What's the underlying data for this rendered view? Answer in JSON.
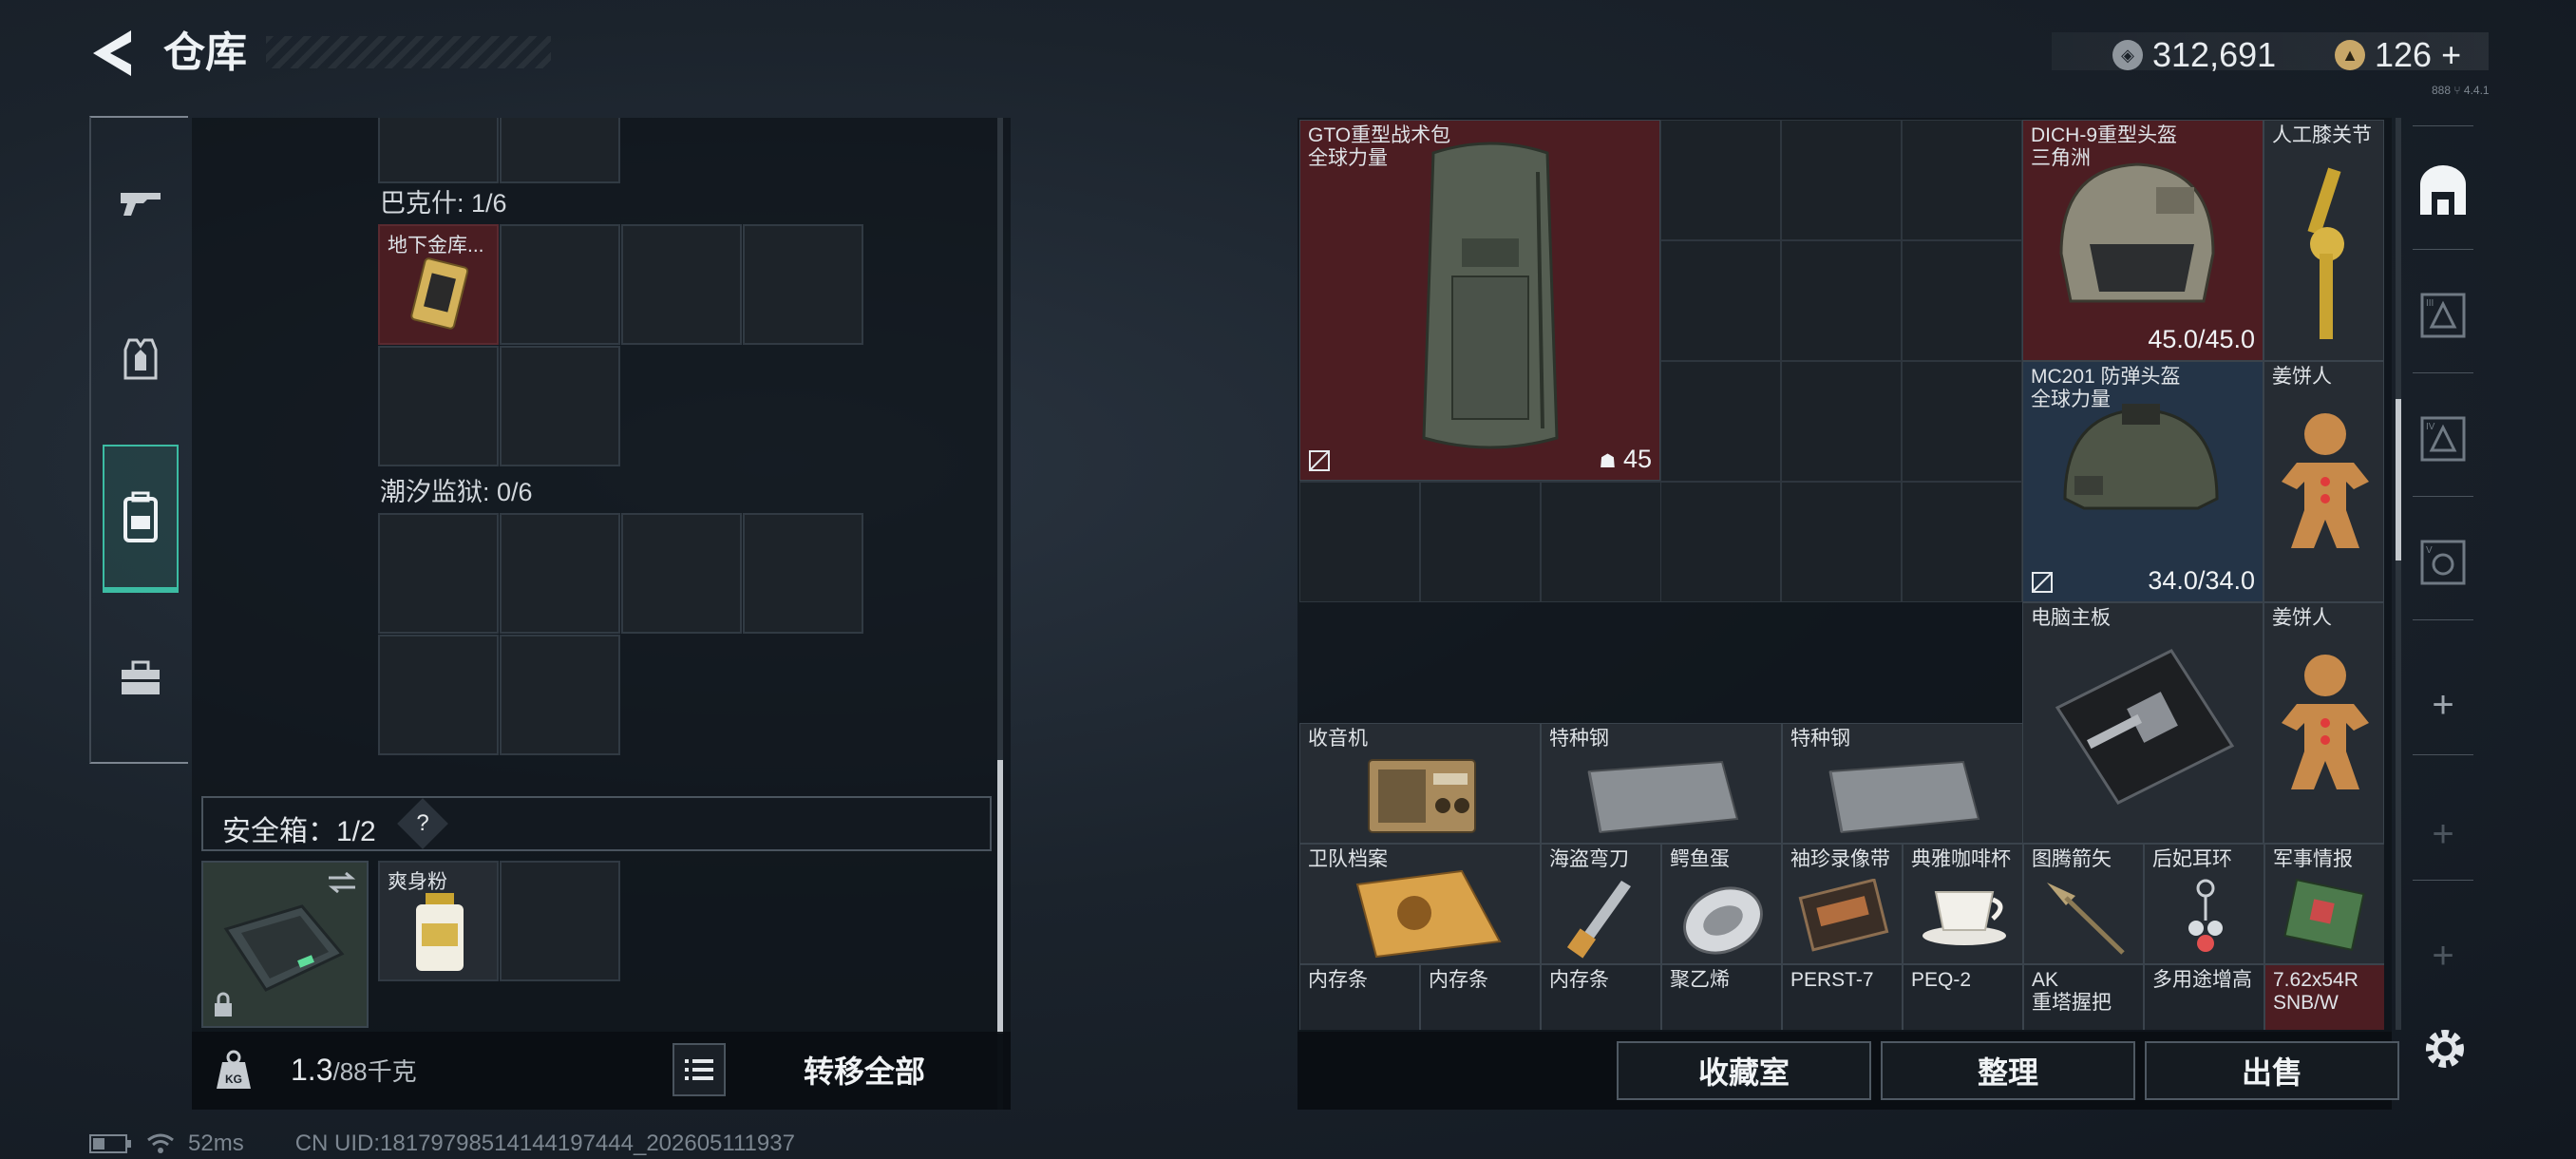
{
  "header": {
    "title": "仓库",
    "currency_1": "312,691",
    "currency_2": "126",
    "currency_2_add": "+",
    "version": "888 ⑂ 4.4.1"
  },
  "left_nav": {
    "items": [
      "weapons",
      "armor",
      "backpack",
      "toolbox"
    ],
    "active": "backpack"
  },
  "left_panel": {
    "section_1": {
      "label": "巴克什: 1/6",
      "item_name": "地下金库..."
    },
    "section_2": {
      "label": "潮汐监狱: 0/6"
    },
    "safe_box": {
      "label": "安全箱：1/2",
      "help": "?",
      "item_name": "爽身粉"
    },
    "weight": {
      "value": "1.3",
      "max": "/88千克"
    },
    "transfer_all": "转移全部"
  },
  "stash": {
    "items": {
      "backpack": {
        "name": "GTO重型战术包",
        "brand": "全球力量",
        "count": "45"
      },
      "helmet_1": {
        "name": "DICH-9重型头盔",
        "brand": "三角洲",
        "durability": "45.0/45.0"
      },
      "knee": {
        "name": "人工膝关节"
      },
      "helmet_2": {
        "name": "MC201 防弹头盔",
        "brand": "全球力量",
        "durability": "34.0/34.0"
      },
      "gingerbread_1": {
        "name": "姜饼人"
      },
      "motherboard": {
        "name": "电脑主板"
      },
      "gingerbread_2": {
        "name": "姜饼人"
      },
      "radio": {
        "name": "收音机"
      },
      "steel_1": {
        "name": "特种钢"
      },
      "steel_2": {
        "name": "特种钢"
      },
      "files": {
        "name": "卫队档案"
      },
      "knife": {
        "name": "海盗弯刀"
      },
      "egg": {
        "name": "鳄鱼蛋"
      },
      "recorder": {
        "name": "袖珍录像带"
      },
      "coffee": {
        "name": "典雅咖啡杯"
      },
      "arrow": {
        "name": "图腾箭矢"
      },
      "earring": {
        "name": "后妃耳环"
      },
      "intel": {
        "name": "军事情报"
      },
      "ram_1": {
        "name": "内存条"
      },
      "ram_2": {
        "name": "内存条"
      },
      "ram_3": {
        "name": "内存条"
      },
      "pe": {
        "name": "聚乙烯"
      },
      "perst": {
        "name": "PERST-7"
      },
      "peq": {
        "name": "PEQ-2"
      },
      "ak": {
        "name": "AK",
        "sub": "重塔握把"
      },
      "multi": {
        "name": "多用途增高"
      },
      "ammo": {
        "name": "7.62x54R",
        "sub": "SNB/W"
      }
    }
  },
  "bottom_right": {
    "collection": "收藏室",
    "sort": "整理",
    "sell": "出售"
  },
  "right_nav": {
    "items": [
      "safe-house",
      "tier-3",
      "tier-4",
      "tier-5",
      "add-1",
      "add-2",
      "add-3"
    ]
  },
  "status": {
    "ping": "52ms",
    "uid": "CN UID:18179798514144197444_202605111937"
  },
  "colors": {
    "accent": "#3cbca3",
    "red_rarity": "#4c1d22",
    "blue_rarity": "#243447"
  }
}
